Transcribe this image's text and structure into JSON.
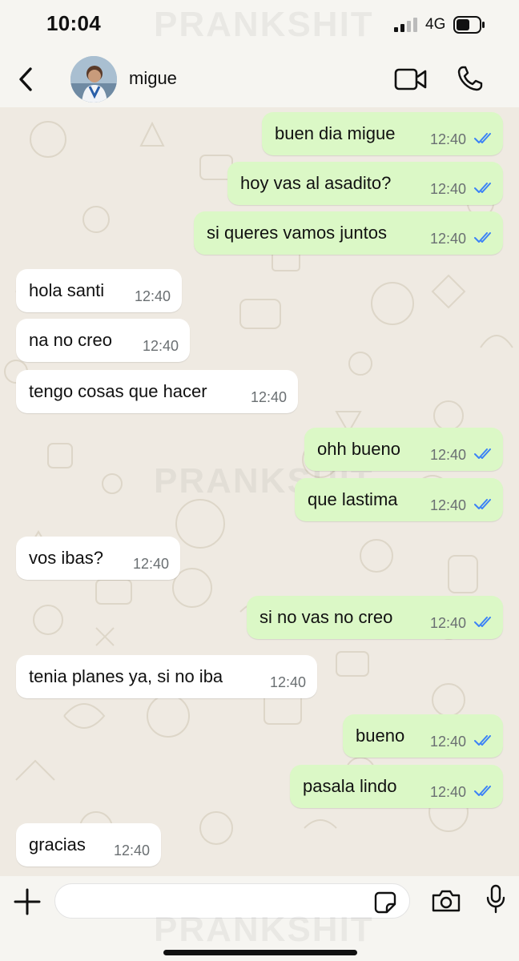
{
  "status_bar": {
    "time": "10:04",
    "network": "4G",
    "watermark": "PRANKSHIT"
  },
  "header": {
    "contact_name": "migue",
    "back_icon": "chevron-left-icon",
    "video_icon": "video-call-icon",
    "call_icon": "phone-icon"
  },
  "messages": [
    {
      "dir": "out",
      "text": "buen dia migue",
      "time": "12:40",
      "status": "read"
    },
    {
      "dir": "out",
      "text": "hoy vas al asadito?",
      "time": "12:40",
      "status": "read"
    },
    {
      "dir": "out",
      "text": "si queres vamos juntos",
      "time": "12:40",
      "status": "read"
    },
    {
      "dir": "in",
      "text": "hola santi",
      "time": "12:40"
    },
    {
      "dir": "in",
      "text": "na no creo",
      "time": "12:40"
    },
    {
      "dir": "in",
      "text": "tengo cosas que hacer",
      "time": "12:40"
    },
    {
      "dir": "out",
      "text": "ohh bueno",
      "time": "12:40",
      "status": "read"
    },
    {
      "dir": "out",
      "text": "que lastima",
      "time": "12:40",
      "status": "read"
    },
    {
      "dir": "in",
      "text": "vos ibas?",
      "time": "12:40"
    },
    {
      "dir": "out",
      "text": "si no vas no creo",
      "time": "12:40",
      "status": "read"
    },
    {
      "dir": "in",
      "text": "tenia planes ya, si no iba",
      "time": "12:40"
    },
    {
      "dir": "out",
      "text": "bueno",
      "time": "12:40",
      "status": "read"
    },
    {
      "dir": "out",
      "text": "pasala lindo",
      "time": "12:40",
      "status": "read"
    },
    {
      "dir": "in",
      "text": "gracias",
      "time": "12:40"
    }
  ],
  "composer": {
    "placeholder": "",
    "value": ""
  },
  "colors": {
    "outgoing_bubble": "#dbf8c6",
    "incoming_bubble": "#ffffff",
    "read_ticks": "#3b82f6",
    "chat_background": "#efeae2"
  }
}
